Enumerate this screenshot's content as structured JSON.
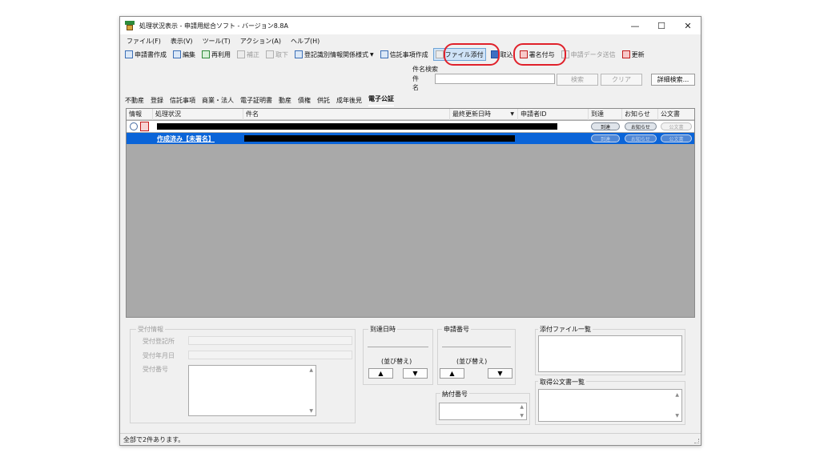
{
  "window": {
    "title": "処理状況表示 - 申請用総合ソフト - バージョン8.8A",
    "minimize": "—",
    "maximize": "☐",
    "close": "✕"
  },
  "menu": [
    "ファイル(F)",
    "表示(V)",
    "ツール(T)",
    "アクション(A)",
    "ヘルプ(H)"
  ],
  "toolbar": {
    "create": "申請書作成",
    "edit": "編集",
    "reuse": "再利用",
    "amend": "補正",
    "withdraw": "取下",
    "register_form": "登記識別情報関係様式",
    "dropdown_arrow": "▼",
    "trust_create": "信託事項作成",
    "attach_file": "ファイル添付",
    "take": "取込",
    "sign": "署名付与",
    "send": "申請データ送信",
    "refresh": "更新"
  },
  "search": {
    "caption": "件名検索",
    "label": "件名",
    "value": "",
    "search_btn": "検索",
    "clear_btn": "クリア",
    "advanced_btn": "詳細検索..."
  },
  "tabs": [
    "不動産",
    "登録",
    "信託事項",
    "商業・法人",
    "電子証明書",
    "動産",
    "債権",
    "供託",
    "成年後見",
    "電子公証"
  ],
  "table": {
    "headers": {
      "info": "情報",
      "status": "処理状況",
      "subject": "件名",
      "updated": "最終更新日時",
      "sort_arrow": "▼",
      "applicant": "申請者ID",
      "arrival": "到達",
      "notice": "お知らせ",
      "official": "公文書"
    },
    "row1": {
      "arrival": "到達",
      "notice": "お知らせ",
      "official": "公文書"
    },
    "row2": {
      "status": "作成済み【未署名】",
      "arrival": "到達",
      "notice": "お知らせ",
      "official": "公文書"
    }
  },
  "details": {
    "receipt_title": "受付情報",
    "receipt_office": "受付登記所",
    "receipt_date": "受付年月日",
    "receipt_number": "受付番号",
    "arrival_time": "到達日時",
    "app_number": "申請番号",
    "sort_label": "(並び替え)",
    "up": "▲",
    "down": "▼",
    "payment_number": "納付番号",
    "attached_files": "添付ファイル一覧",
    "obtained_docs": "取得公文書一覧"
  },
  "status_text": "全部で2件あります。"
}
